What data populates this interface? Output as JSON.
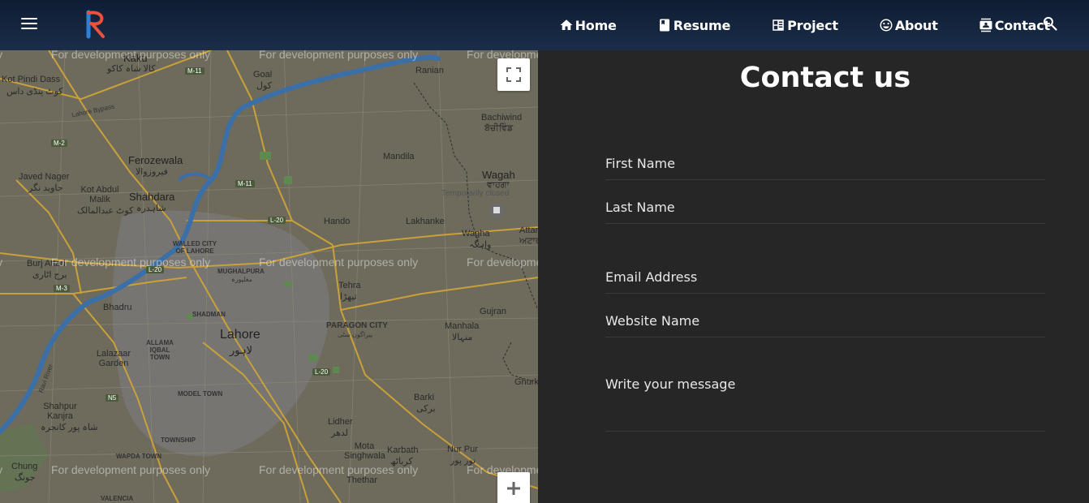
{
  "nav": {
    "items": [
      {
        "label": "Home",
        "icon": "home-icon"
      },
      {
        "label": "Resume",
        "icon": "resume-icon"
      },
      {
        "label": "Project",
        "icon": "project-icon"
      },
      {
        "label": "About",
        "icon": "smile-icon"
      },
      {
        "label": "Contact",
        "icon": "contact-icon"
      }
    ]
  },
  "map": {
    "watermark": "For development purposes only",
    "labels": {
      "kaku": "Kaku",
      "kaku_ur": "کالا شاہ کاکو",
      "kot_pindi": "Kot Pindi Dass",
      "kot_pindi_ur": "کوٹ پنڈی داس",
      "goal": "Goal",
      "goal_ur": "کول",
      "ranian": "Ranian",
      "bachiwind": "Bachiwind",
      "bachiwind_pa": "ਬੱਚੀਵਿੰਡ",
      "lahore_bypass": "Lahore Bypass",
      "ferozewala": "Ferozewala",
      "ferozewala_ur": "فیروزوالا",
      "mandila": "Mandila",
      "wagah": "Wagah",
      "wagah_pa": "ਵਾਹਗਾ",
      "temporarily_closed": "Temporarily closed",
      "javed_nager": "Javed Nager",
      "javed_nager_ur": "جاوید نگر",
      "kot_abdul_malik": "Kot Abdul Malik",
      "kot_abdul_malik_ur": "کوٹ عبدالمالک",
      "shahdara": "Shahdara",
      "shahdara_ur": "شاہدرہ",
      "hando": "Hando",
      "lakhanke": "Lakhanke",
      "wagha": "Wagha",
      "wagha_ur": "واہگہ",
      "attari": "Attari",
      "attari_pa": "ਅਟਾਰੀ",
      "walled_city": "WALLED CITY OF LAHORE",
      "burj_attari": "Burj Attari",
      "burj_attari_ur": "برج اٹاری",
      "mughalpura": "MUGHALPURA",
      "mughalpura_ur": "مغلپورہ",
      "tehra": "Tehra",
      "tehra_ur": "تیھڑا",
      "bhadru": "Bhadru",
      "shadman": "SHADMAN",
      "gujran": "Gujran",
      "lahore": "Lahore",
      "lahore_ur": "لاہور",
      "paragon_city": "PARAGON CITY",
      "paragon_city_ur": "پیراگون سٹی",
      "manhala": "Manhala",
      "manhala_ur": "منہالا",
      "allama_iqbal": "ALLAMA IQBAL TOWN",
      "lalazaar_garden": "Lalazaar Garden",
      "ghurki": "Ghurk",
      "model_town": "MODEL TOWN",
      "barki": "Barki",
      "barki_ur": "برکی",
      "shahpur_kanjra": "Shahpur Kanjra",
      "shahpur_kanjra_ur": "شاہ پور کانجرہ",
      "lidher": "Lidher",
      "lidher_ur": "لدھر",
      "township": "TOWNSHIP",
      "mota_singhwala": "Mota Singhwala",
      "karbath": "Karbath",
      "karbath_ur": "کرباٹھ",
      "nur_pur": "Nur Pur",
      "nur_pur_ur": "نور پور",
      "thethar": "Thethar",
      "chung": "Chung",
      "chung_ur": "جونگ",
      "wapda_town": "WAPDA TOWN",
      "valencia": "VALENCIA",
      "ravi_river": "Ravi River"
    },
    "badges": [
      "M-11",
      "M-2",
      "M-11",
      "L-20",
      "L-20",
      "L-20",
      "M-3",
      "N5"
    ]
  },
  "contact": {
    "title": "Contact us",
    "fields": {
      "first_name": "First Name",
      "last_name": "Last Name",
      "email": "Email Address",
      "website": "Website Name",
      "message": "Write your message"
    }
  }
}
